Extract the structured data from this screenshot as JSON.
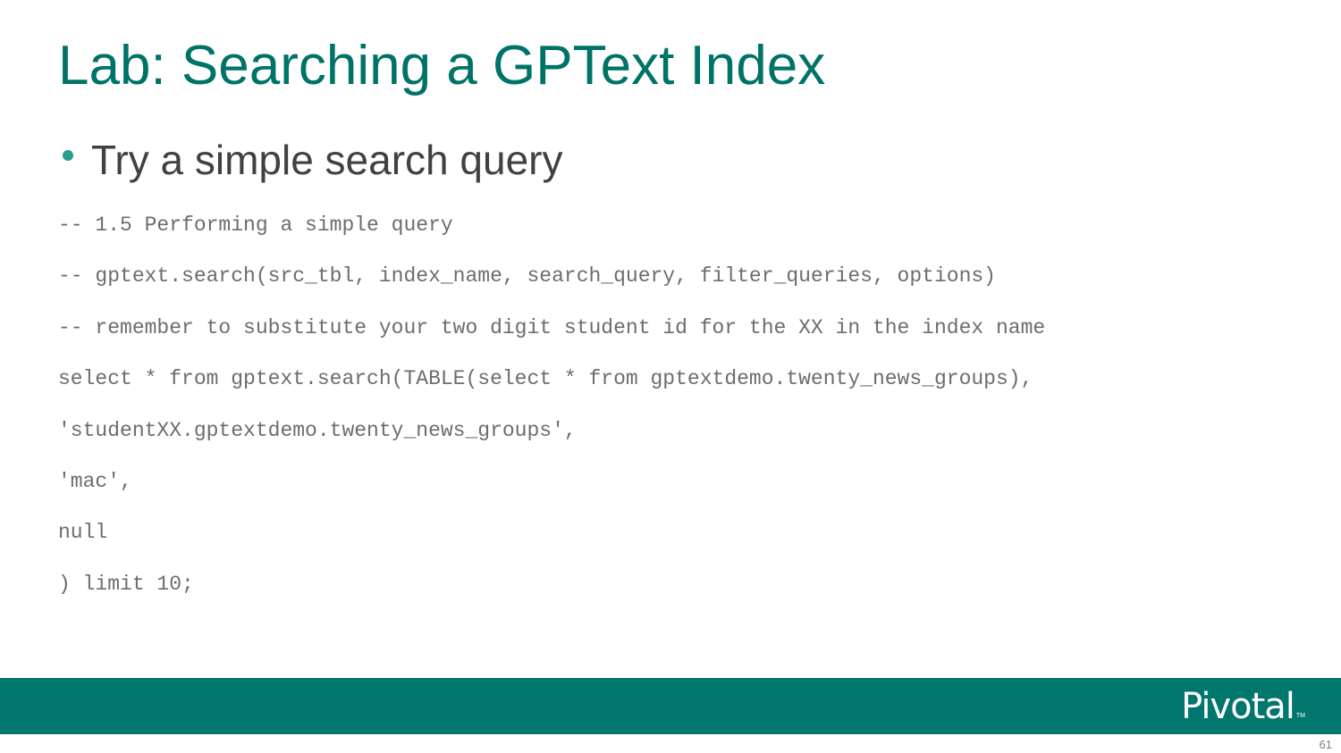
{
  "slide": {
    "title": "Lab: Searching a GPText Index",
    "bullet": "Try a simple search query",
    "code_lines": [
      "-- 1.5 Performing a simple query",
      "-- gptext.search(src_tbl, index_name, search_query, filter_queries, options)",
      "-- remember to substitute your two digit student id for the XX in the index name",
      "select * from gptext.search(TABLE(select * from gptextdemo.twenty_news_groups),",
      "'studentXX.gptextdemo.twenty_news_groups',",
      "'mac',",
      "null",
      ") limit 10;"
    ],
    "page_number": "61"
  },
  "footer": {
    "logo_text": "Pivotal",
    "logo_tm": "TM",
    "bar_color": "#00766d"
  },
  "colors": {
    "title": "#007367",
    "bullet_dot": "#2a9d8f",
    "body_text": "#414142",
    "code_text": "#6d6d6d"
  }
}
